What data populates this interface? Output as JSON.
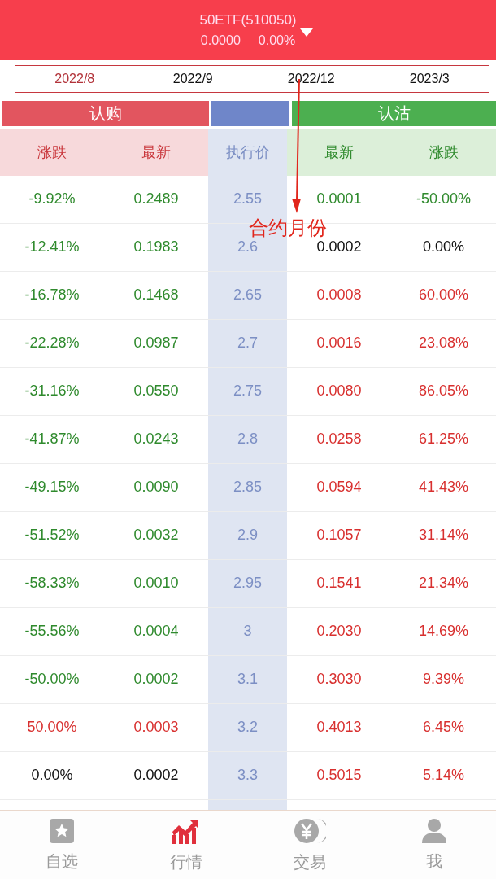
{
  "header": {
    "title": "50ETF(510050)",
    "price": "0.0000",
    "change": "0.00%"
  },
  "months": [
    {
      "label": "2022/8",
      "selected": true
    },
    {
      "label": "2022/9",
      "selected": false
    },
    {
      "label": "2022/12",
      "selected": false
    },
    {
      "label": "2023/3",
      "selected": false
    }
  ],
  "annotation": {
    "label": "合约月份"
  },
  "sections": {
    "call": "认购",
    "put": "认沽"
  },
  "columns": [
    "涨跌",
    "最新",
    "执行价",
    "最新",
    "涨跌"
  ],
  "rows": [
    {
      "call_change": {
        "text": "-9.92%",
        "color": "#2f8a2d"
      },
      "call_last": {
        "text": "0.2489",
        "color": "#2f8a2d"
      },
      "strike": "2.55",
      "put_last": {
        "text": "0.0001",
        "color": "#2f8a2d"
      },
      "put_change": {
        "text": "-50.00%",
        "color": "#2f8a2d"
      }
    },
    {
      "call_change": {
        "text": "-12.41%",
        "color": "#2f8a2d"
      },
      "call_last": {
        "text": "0.1983",
        "color": "#2f8a2d"
      },
      "strike": "2.6",
      "put_last": {
        "text": "0.0002",
        "color": "#111111"
      },
      "put_change": {
        "text": "0.00%",
        "color": "#111111"
      }
    },
    {
      "call_change": {
        "text": "-16.78%",
        "color": "#2f8a2d"
      },
      "call_last": {
        "text": "0.1468",
        "color": "#2f8a2d"
      },
      "strike": "2.65",
      "put_last": {
        "text": "0.0008",
        "color": "#d8302f"
      },
      "put_change": {
        "text": "60.00%",
        "color": "#d8302f"
      }
    },
    {
      "call_change": {
        "text": "-22.28%",
        "color": "#2f8a2d"
      },
      "call_last": {
        "text": "0.0987",
        "color": "#2f8a2d"
      },
      "strike": "2.7",
      "put_last": {
        "text": "0.0016",
        "color": "#d8302f"
      },
      "put_change": {
        "text": "23.08%",
        "color": "#d8302f"
      }
    },
    {
      "call_change": {
        "text": "-31.16%",
        "color": "#2f8a2d"
      },
      "call_last": {
        "text": "0.0550",
        "color": "#2f8a2d"
      },
      "strike": "2.75",
      "put_last": {
        "text": "0.0080",
        "color": "#d8302f"
      },
      "put_change": {
        "text": "86.05%",
        "color": "#d8302f"
      }
    },
    {
      "call_change": {
        "text": "-41.87%",
        "color": "#2f8a2d"
      },
      "call_last": {
        "text": "0.0243",
        "color": "#2f8a2d"
      },
      "strike": "2.8",
      "put_last": {
        "text": "0.0258",
        "color": "#d8302f"
      },
      "put_change": {
        "text": "61.25%",
        "color": "#d8302f"
      }
    },
    {
      "call_change": {
        "text": "-49.15%",
        "color": "#2f8a2d"
      },
      "call_last": {
        "text": "0.0090",
        "color": "#2f8a2d"
      },
      "strike": "2.85",
      "put_last": {
        "text": "0.0594",
        "color": "#d8302f"
      },
      "put_change": {
        "text": "41.43%",
        "color": "#d8302f"
      }
    },
    {
      "call_change": {
        "text": "-51.52%",
        "color": "#2f8a2d"
      },
      "call_last": {
        "text": "0.0032",
        "color": "#2f8a2d"
      },
      "strike": "2.9",
      "put_last": {
        "text": "0.1057",
        "color": "#d8302f"
      },
      "put_change": {
        "text": "31.14%",
        "color": "#d8302f"
      }
    },
    {
      "call_change": {
        "text": "-58.33%",
        "color": "#2f8a2d"
      },
      "call_last": {
        "text": "0.0010",
        "color": "#2f8a2d"
      },
      "strike": "2.95",
      "put_last": {
        "text": "0.1541",
        "color": "#d8302f"
      },
      "put_change": {
        "text": "21.34%",
        "color": "#d8302f"
      }
    },
    {
      "call_change": {
        "text": "-55.56%",
        "color": "#2f8a2d"
      },
      "call_last": {
        "text": "0.0004",
        "color": "#2f8a2d"
      },
      "strike": "3",
      "put_last": {
        "text": "0.2030",
        "color": "#d8302f"
      },
      "put_change": {
        "text": "14.69%",
        "color": "#d8302f"
      }
    },
    {
      "call_change": {
        "text": "-50.00%",
        "color": "#2f8a2d"
      },
      "call_last": {
        "text": "0.0002",
        "color": "#2f8a2d"
      },
      "strike": "3.1",
      "put_last": {
        "text": "0.3030",
        "color": "#d8302f"
      },
      "put_change": {
        "text": "9.39%",
        "color": "#d8302f"
      }
    },
    {
      "call_change": {
        "text": "50.00%",
        "color": "#d8302f"
      },
      "call_last": {
        "text": "0.0003",
        "color": "#d8302f"
      },
      "strike": "3.2",
      "put_last": {
        "text": "0.4013",
        "color": "#d8302f"
      },
      "put_change": {
        "text": "6.45%",
        "color": "#d8302f"
      }
    },
    {
      "call_change": {
        "text": "0.00%",
        "color": "#111111"
      },
      "call_last": {
        "text": "0.0002",
        "color": "#111111"
      },
      "strike": "3.3",
      "put_last": {
        "text": "0.5015",
        "color": "#d8302f"
      },
      "put_change": {
        "text": "5.14%",
        "color": "#d8302f"
      }
    }
  ],
  "nav": [
    {
      "label": "自选",
      "kind": "star",
      "selected": false
    },
    {
      "label": "行情",
      "kind": "chart",
      "selected": true
    },
    {
      "label": "交易",
      "kind": "coin",
      "selected": false
    },
    {
      "label": "我",
      "kind": "person",
      "selected": false
    }
  ]
}
